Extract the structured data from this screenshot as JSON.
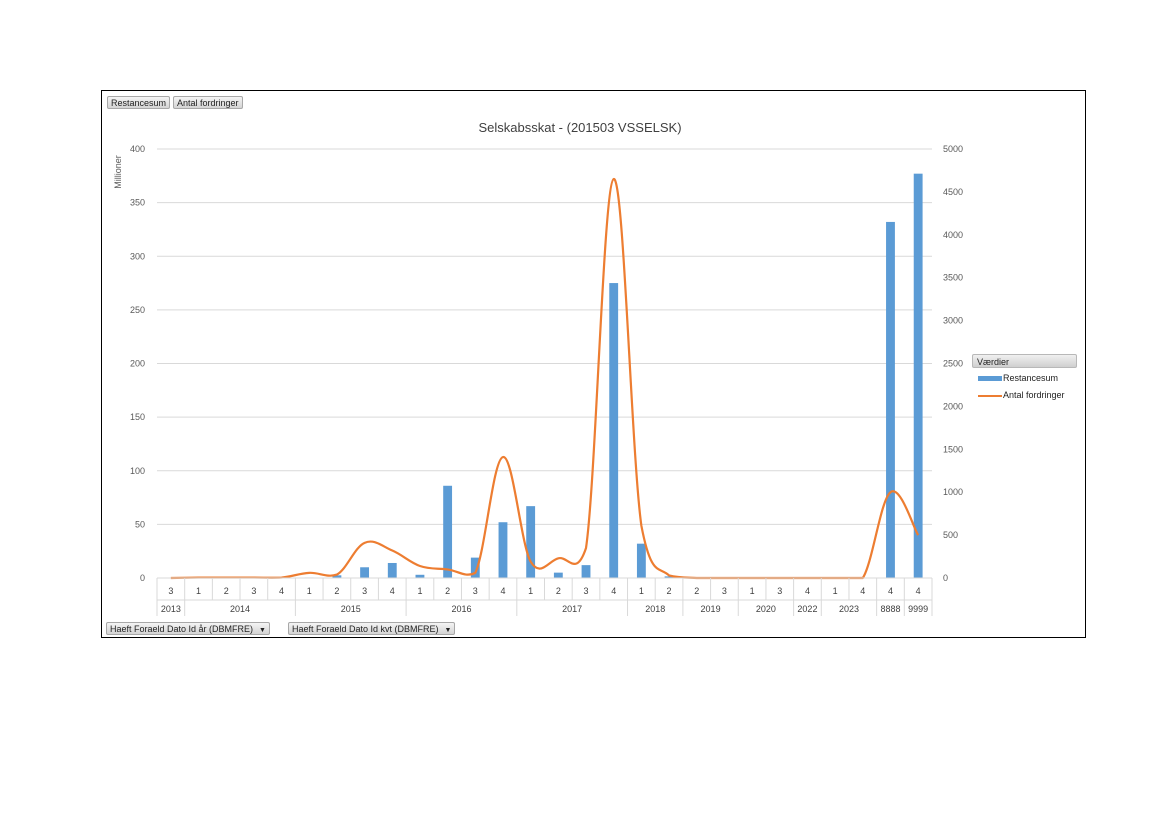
{
  "chart_data": {
    "type": "bar",
    "combo": "bar+line",
    "title": "Selskabsskat - (201503 VSSELSK)",
    "ylabel": "Millioner",
    "ylim": [
      0,
      400
    ],
    "y2lim": [
      0,
      5000
    ],
    "yticks": [
      "0",
      "50",
      "100",
      "150",
      "200",
      "250",
      "300",
      "350",
      "400"
    ],
    "y2ticks": [
      "0",
      "500",
      "1000",
      "1500",
      "2000",
      "2500",
      "3000",
      "3500",
      "4000",
      "4500",
      "5000"
    ],
    "grid": true,
    "legend_position": "right",
    "legend_title": "Værdier",
    "categories": [
      {
        "year": "2013",
        "q": "3"
      },
      {
        "year": "2014",
        "q": "1"
      },
      {
        "year": "2014",
        "q": "2"
      },
      {
        "year": "2014",
        "q": "3"
      },
      {
        "year": "2014",
        "q": "4"
      },
      {
        "year": "2015",
        "q": "1"
      },
      {
        "year": "2015",
        "q": "2"
      },
      {
        "year": "2015",
        "q": "3"
      },
      {
        "year": "2015",
        "q": "4"
      },
      {
        "year": "2016",
        "q": "1"
      },
      {
        "year": "2016",
        "q": "2"
      },
      {
        "year": "2016",
        "q": "3"
      },
      {
        "year": "2016",
        "q": "4"
      },
      {
        "year": "2017",
        "q": "1"
      },
      {
        "year": "2017",
        "q": "2"
      },
      {
        "year": "2017",
        "q": "3"
      },
      {
        "year": "2017",
        "q": "4"
      },
      {
        "year": "2018",
        "q": "1"
      },
      {
        "year": "2018",
        "q": "2"
      },
      {
        "year": "2019",
        "q": "2"
      },
      {
        "year": "2019",
        "q": "3"
      },
      {
        "year": "2020",
        "q": "1"
      },
      {
        "year": "2020",
        "q": "3"
      },
      {
        "year": "2022",
        "q": "4"
      },
      {
        "year": "2023",
        "q": "1"
      },
      {
        "year": "2023",
        "q": "4"
      },
      {
        "year": "8888",
        "q": "4"
      },
      {
        "year": "9999",
        "q": "4"
      }
    ],
    "year_groups": [
      "2013",
      "2014",
      "2015",
      "2016",
      "2017",
      "2018",
      "2019",
      "2020",
      "2022",
      "2023",
      "8888",
      "9999"
    ],
    "series": [
      {
        "name": "Restancesum",
        "axis": "left",
        "type": "bar",
        "color": "#5b9bd5",
        "values": [
          0,
          0,
          0,
          0,
          0,
          0.5,
          2.5,
          10,
          14,
          3,
          86,
          19,
          52,
          67,
          5,
          12,
          275,
          32,
          1.5,
          0,
          0,
          0,
          0,
          0,
          0,
          0,
          332,
          377
        ]
      },
      {
        "name": "Antal fordringer",
        "axis": "right",
        "type": "line",
        "color": "#ed7d31",
        "values": [
          0,
          5,
          5,
          5,
          5,
          60,
          40,
          410,
          320,
          140,
          100,
          60,
          1410,
          190,
          230,
          350,
          4650,
          610,
          30,
          0,
          0,
          0,
          0,
          0,
          0,
          0,
          1000,
          500
        ]
      }
    ]
  },
  "pivot_buttons": {
    "top": [
      "Restancesum",
      "Antal fordringer"
    ],
    "bottom": [
      "Haeft Foraeld Dato Id år (DBMFRE)",
      "Haeft Foraeld Dato Id kvt (DBMFRE)"
    ]
  }
}
